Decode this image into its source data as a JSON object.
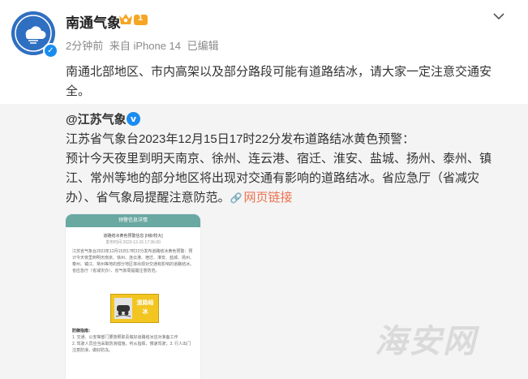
{
  "post": {
    "author": "南通气象",
    "vip_level": "1",
    "time": "2分钟前",
    "source": "来自 iPhone 14",
    "edited": "已编辑",
    "text": "南通北部地区、市内高架以及部分路段可能有道路结冰，请大家一定注意交通安全。",
    "more_icon": "chevron-down-icon"
  },
  "repost": {
    "author": "@江苏气象",
    "verified_mark": "v",
    "line1": "江苏省气象台2023年12月15日17时22分发布道路结冰黄色预警：",
    "line2": "预计今天夜里到明天南京、徐州、连云港、宿迁、淮安、盐城、扬州、泰州、镇江、常州等地的部分地区将出现对交通有影响的道路结冰。省应急厅（省减灾办）、省气象局提醒注意防范。",
    "link_text": "网页链接",
    "link_icon": "link-icon"
  },
  "thumbnail": {
    "header": "预警信息详情",
    "title": "道路结冰黄色预警信息 [II级/较大]",
    "timestamp": "发布时间 2023-12-15 17:36:00",
    "body": "江苏省气象台2023年12月15日17时22分发布道路结冰黄色预警：预计今天夜里到明天南京、徐州、连云港、宿迁、淮安、盐城、扬州、泰州、镇江、常州等地的部分地区将出现对交通有影响的道路结冰。省应急厅（省减灾办）、省气象局提醒注意防范。",
    "sign_text": "道路结冰",
    "guide_title": "防御指南：",
    "guide_1": "1. 交通、公安等部门要按照职责做好道路结冰应对准备工作",
    "guide_2": "2. 驾驶人员应当采取防滑措施，听从指挥，慢速驾驶；3. 行人出门注意防滑，做好防冻。"
  },
  "watermark": "海安网"
}
